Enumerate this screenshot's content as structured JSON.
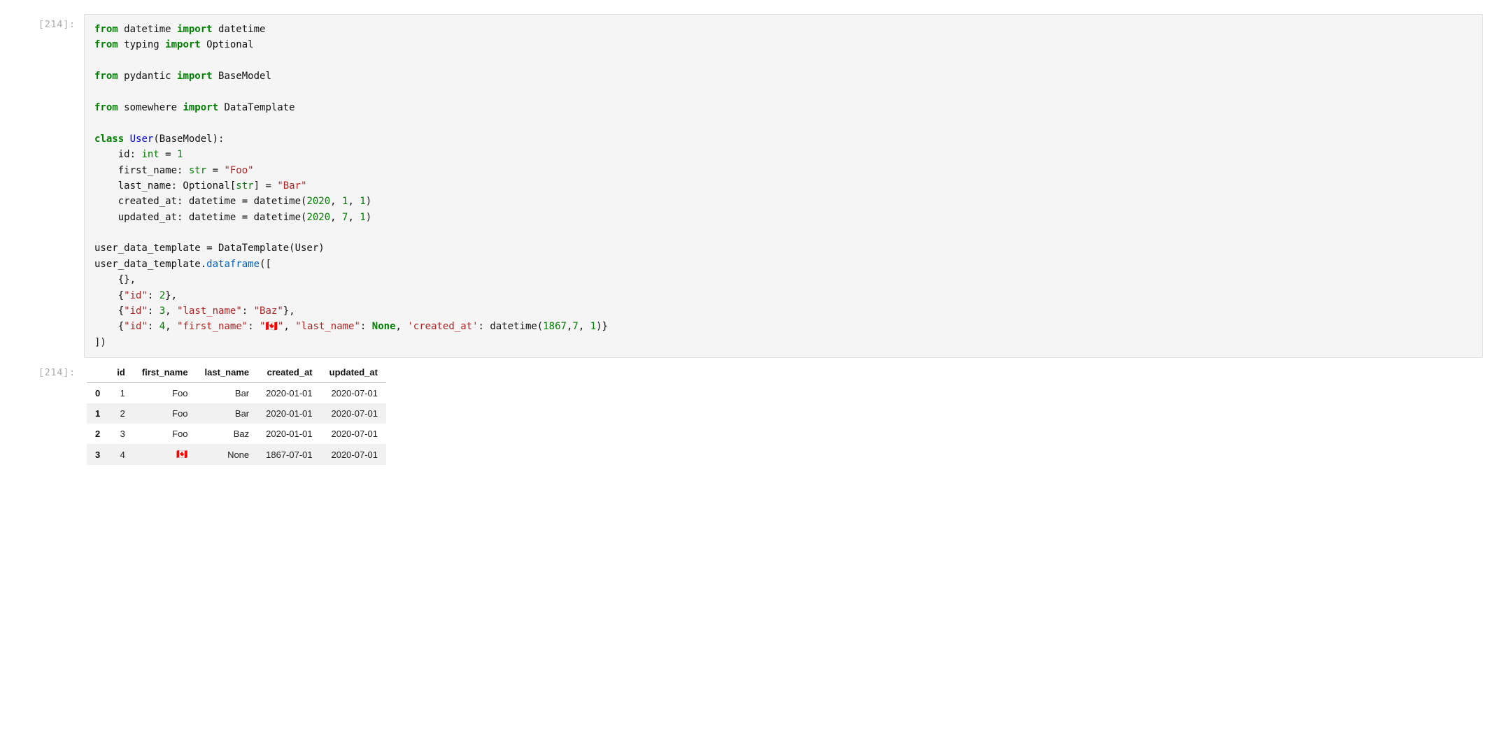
{
  "input_cell": {
    "prompt": "[214]:",
    "code": {
      "lines": [
        {
          "t": "import",
          "parts": [
            {
              "c": "kw-green",
              "s": "from"
            },
            {
              "s": " datetime "
            },
            {
              "c": "kw-green",
              "s": "import"
            },
            {
              "s": " datetime"
            }
          ]
        },
        {
          "t": "import",
          "parts": [
            {
              "c": "kw-green",
              "s": "from"
            },
            {
              "s": " typing "
            },
            {
              "c": "kw-green",
              "s": "import"
            },
            {
              "s": " Optional"
            }
          ]
        },
        {
          "t": "blank"
        },
        {
          "t": "import",
          "parts": [
            {
              "c": "kw-green",
              "s": "from"
            },
            {
              "s": " pydantic "
            },
            {
              "c": "kw-green",
              "s": "import"
            },
            {
              "s": " BaseModel"
            }
          ]
        },
        {
          "t": "blank"
        },
        {
          "t": "import",
          "parts": [
            {
              "c": "kw-green",
              "s": "from"
            },
            {
              "s": " somewhere "
            },
            {
              "c": "kw-green",
              "s": "import"
            },
            {
              "s": " DataTemplate"
            }
          ]
        },
        {
          "t": "blank"
        },
        {
          "t": "class",
          "parts": [
            {
              "c": "kw-green",
              "s": "class"
            },
            {
              "s": " "
            },
            {
              "c": "name-blue",
              "s": "User"
            },
            {
              "s": "(BaseModel):"
            }
          ]
        },
        {
          "t": "field",
          "parts": [
            {
              "s": "    id: "
            },
            {
              "c": "type-green",
              "s": "int"
            },
            {
              "s": " = "
            },
            {
              "c": "num",
              "s": "1"
            }
          ]
        },
        {
          "t": "field",
          "parts": [
            {
              "s": "    first_name: "
            },
            {
              "c": "type-green",
              "s": "str"
            },
            {
              "s": " = "
            },
            {
              "c": "str",
              "s": "\"Foo\""
            }
          ]
        },
        {
          "t": "field",
          "parts": [
            {
              "s": "    last_name: Optional["
            },
            {
              "c": "type-green",
              "s": "str"
            },
            {
              "s": "] = "
            },
            {
              "c": "str",
              "s": "\"Bar\""
            }
          ]
        },
        {
          "t": "field",
          "parts": [
            {
              "s": "    created_at: datetime = datetime("
            },
            {
              "c": "num",
              "s": "2020"
            },
            {
              "s": ", "
            },
            {
              "c": "num",
              "s": "1"
            },
            {
              "s": ", "
            },
            {
              "c": "num",
              "s": "1"
            },
            {
              "s": ")"
            }
          ]
        },
        {
          "t": "field",
          "parts": [
            {
              "s": "    updated_at: datetime = datetime("
            },
            {
              "c": "num",
              "s": "2020"
            },
            {
              "s": ", "
            },
            {
              "c": "num",
              "s": "7"
            },
            {
              "s": ", "
            },
            {
              "c": "num",
              "s": "1"
            },
            {
              "s": ")"
            }
          ]
        },
        {
          "t": "blank"
        },
        {
          "t": "stmt",
          "parts": [
            {
              "s": "user_data_template = DataTemplate(User)"
            }
          ]
        },
        {
          "t": "stmt",
          "parts": [
            {
              "s": "user_data_template."
            },
            {
              "c": "attr-blue",
              "s": "dataframe"
            },
            {
              "s": "(["
            }
          ]
        },
        {
          "t": "dict",
          "parts": [
            {
              "s": "    {},"
            }
          ]
        },
        {
          "t": "dict",
          "parts": [
            {
              "s": "    {"
            },
            {
              "c": "str",
              "s": "\"id\""
            },
            {
              "s": ": "
            },
            {
              "c": "num",
              "s": "2"
            },
            {
              "s": "},"
            }
          ]
        },
        {
          "t": "dict",
          "parts": [
            {
              "s": "    {"
            },
            {
              "c": "str",
              "s": "\"id\""
            },
            {
              "s": ": "
            },
            {
              "c": "num",
              "s": "3"
            },
            {
              "s": ", "
            },
            {
              "c": "str",
              "s": "\"last_name\""
            },
            {
              "s": ": "
            },
            {
              "c": "str",
              "s": "\"Baz\""
            },
            {
              "s": "},"
            }
          ]
        },
        {
          "t": "dict",
          "parts": [
            {
              "s": "    {"
            },
            {
              "c": "str",
              "s": "\"id\""
            },
            {
              "s": ": "
            },
            {
              "c": "num",
              "s": "4"
            },
            {
              "s": ", "
            },
            {
              "c": "str",
              "s": "\"first_name\""
            },
            {
              "s": ": "
            },
            {
              "c": "str",
              "s": "\"🇨🇦\""
            },
            {
              "s": ", "
            },
            {
              "c": "str",
              "s": "\"last_name\""
            },
            {
              "s": ": "
            },
            {
              "c": "none-green",
              "s": "None"
            },
            {
              "s": ", "
            },
            {
              "c": "str",
              "s": "'created_at'"
            },
            {
              "s": ": datetime("
            },
            {
              "c": "num",
              "s": "1867"
            },
            {
              "s": ","
            },
            {
              "c": "num",
              "s": "7"
            },
            {
              "s": ", "
            },
            {
              "c": "num",
              "s": "1"
            },
            {
              "s": ")}"
            }
          ]
        },
        {
          "t": "stmt",
          "parts": [
            {
              "s": "])"
            }
          ]
        }
      ]
    }
  },
  "output_cell": {
    "prompt": "[214]:",
    "dataframe": {
      "columns": [
        "id",
        "first_name",
        "last_name",
        "created_at",
        "updated_at"
      ],
      "index": [
        "0",
        "1",
        "2",
        "3"
      ],
      "rows": [
        [
          "1",
          "Foo",
          "Bar",
          "2020-01-01",
          "2020-07-01"
        ],
        [
          "2",
          "Foo",
          "Bar",
          "2020-01-01",
          "2020-07-01"
        ],
        [
          "3",
          "Foo",
          "Baz",
          "2020-01-01",
          "2020-07-01"
        ],
        [
          "4",
          "🇨🇦",
          "None",
          "1867-07-01",
          "2020-07-01"
        ]
      ]
    }
  }
}
